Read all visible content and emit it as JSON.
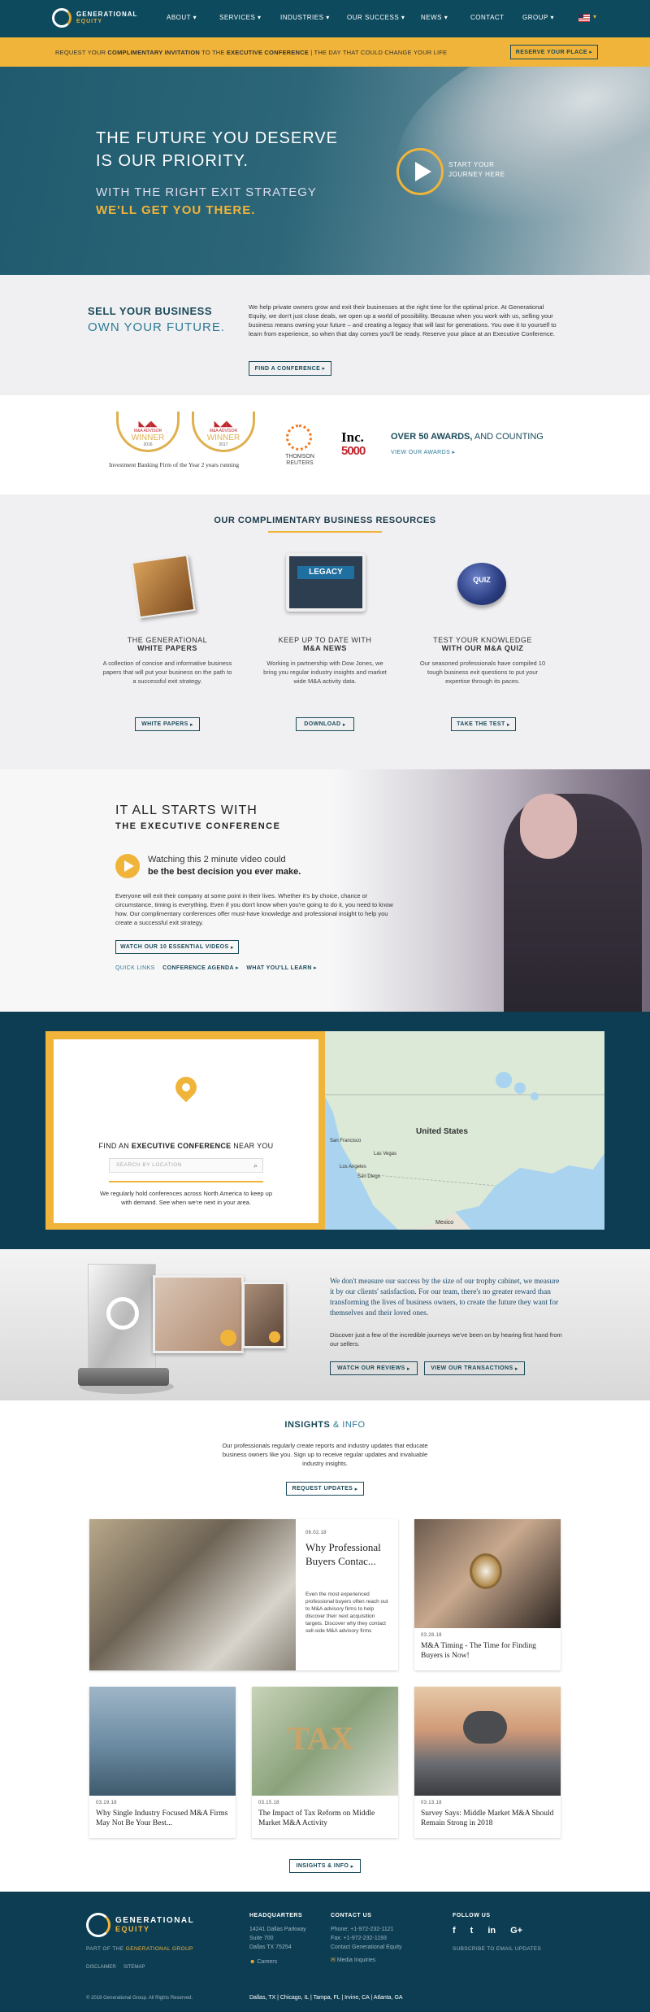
{
  "header": {
    "logo_line1": "GENERATIONAL",
    "logo_line2": "EQUITY",
    "nav": [
      "ABOUT",
      "SERVICES",
      "INDUSTRIES",
      "OUR SUCCESS",
      "NEWS",
      "CONTACT",
      "GROUP"
    ]
  },
  "banner": {
    "part1": "REQUEST YOUR ",
    "bold1": "COMPLIMENTARY INVITATION",
    "part2": " TO THE ",
    "bold2": "EXECUTIVE CONFERENCE",
    "part3": "  |  THE DAY THAT COULD CHANGE YOUR LIFE",
    "button": "RESERVE YOUR PLACE"
  },
  "hero": {
    "title_line1": "THE FUTURE YOU DESERVE",
    "title_line2": "IS OUR PRIORITY.",
    "sub1": "WITH THE RIGHT EXIT STRATEGY",
    "sub2": "WE'LL GET YOU THERE.",
    "start_line1": "START YOUR",
    "start_line2": "JOURNEY HERE"
  },
  "sell": {
    "title1": "SELL YOUR BUSINESS",
    "title2": "OWN YOUR FUTURE.",
    "paragraph": "We help private owners grow and exit their businesses at the right time for the optimal price. At Generational Equity, we don't just close deals, we open up a world of possibility. Because when you work with us, selling your business means owning your future – and creating a legacy that will last for generations. You owe it to yourself to learn from experience, so when that day comes you'll be ready. Reserve your place at an Executive Conference.",
    "button": "FIND A CONFERENCE"
  },
  "awards": {
    "badge1_brand": "M&A ADVISOR",
    "badge1_word": "WINNER",
    "badge1_year": "2016",
    "badge2_brand": "M&A ADVISOR",
    "badge2_word": "WINNER",
    "badge2_year": "2017",
    "caption": "Investment Banking Firm of the Year 2 years running",
    "thomson1": "THOMSON",
    "thomson2": "REUTERS",
    "inc_word": "Inc.",
    "inc_num": "5000",
    "count_bold": "OVER 50 AWARDS,",
    "count_rest": " AND COUNTING",
    "view": "VIEW OUR AWARDS"
  },
  "resources": {
    "heading": "OUR COMPLIMENTARY BUSINESS RESOURCES",
    "items": [
      {
        "t1": "THE GENERATIONAL",
        "t2": "WHITE PAPERS",
        "desc": "A collection of concise and informative business papers that will put your business on the path to a successful exit strategy.",
        "button": "WHITE PAPERS"
      },
      {
        "t1": "KEEP UP TO DATE WITH",
        "t2": "M&A NEWS",
        "desc": "Working in partnership with Dow Jones, we bring you regular industry insights and market wide M&A activity data.",
        "button": "DOWNLOAD"
      },
      {
        "t1": "TEST YOUR KNOWLEDGE",
        "t2": "WITH OUR M&A QUIZ",
        "desc": "Our seasoned professionals have compiled 10 tough business exit questions to put your expertise through its paces.",
        "button": "TAKE THE TEST"
      }
    ],
    "legacy_label": "LEGACY",
    "quiz_label": "QUIZ"
  },
  "video": {
    "h1": "IT ALL STARTS WITH",
    "h2": "THE EXECUTIVE CONFERENCE",
    "watch1": "Watching this 2 minute video could",
    "watch2": "be the best decision you ever make.",
    "paragraph": "Everyone will exit their company at some point in their lives. Whether it's by choice, chance or circumstance, timing is everything. Even if you don't know when you're going to do it, you need to know how. Our complimentary conferences offer must-have knowledge and professional insight to help you create a successful exit strategy.",
    "button": "WATCH OUR 10 ESSENTIAL VIDEOS",
    "quick": "QUICK LINKS",
    "link1": "CONFERENCE AGENDA",
    "link2": "WHAT YOU'LL LEARN"
  },
  "find": {
    "title_pre": "FIND AN ",
    "title_bold": "EXECUTIVE CONFERENCE",
    "title_post": " NEAR YOU",
    "placeholder": "SEARCH BY LOCATION",
    "desc": "We regularly hold conferences across North America to keep up with demand. See when we're next in your area.",
    "map_us": "United States",
    "map_mexico": "Mexico",
    "map_sf": "San Francisco",
    "map_la": "Los Angeles",
    "map_sd": "San Diego",
    "map_lv": "Las Vegas"
  },
  "trophy": {
    "quote": "We don't measure our success by the size of our trophy cabinet, we measure it by our clients' satisfaction. For our team, there's no greater reward than transforming the lives of business owners, to create the future they want for themselves and their loved ones.",
    "desc": "Discover just a few of the incredible journeys we've been on by hearing first hand from our sellers.",
    "button1": "WATCH OUR REVIEWS",
    "button2": "VIEW OUR TRANSACTIONS"
  },
  "insights": {
    "title_bold": "INSIGHTS",
    "title_rest": " & INFO",
    "desc": "Our professionals regularly create reports and industry updates that educate business owners like you. Sign up to receive regular updates and invaluable industry insights.",
    "button": "REQUEST UPDATES",
    "featured": {
      "date": "06.02.18",
      "title": "Why Professional Buyers Contac...",
      "excerpt": "Even the most experienced professional buyers often reach out to M&A advisory firms to help discover their next acquisition targets. Discover why they contact sell-side M&A advisory firms"
    },
    "cards": [
      {
        "date": "03.28.18",
        "title": "M&A Timing - The Time for Finding Buyers is Now!"
      },
      {
        "date": "03.19.18",
        "title": "Why Single Industry Focused M&A Firms May Not Be Your Best..."
      },
      {
        "date": "03.15.18",
        "title": "The Impact of Tax Reform on Middle Market M&A Activity"
      },
      {
        "date": "03.13.18",
        "title": "Survey Says: Middle Market M&A Should Remain Strong in 2018"
      }
    ],
    "tax_label": "TAX",
    "more_button": "INSIGHTS & INFO"
  },
  "footer": {
    "logo1": "GENERATIONAL",
    "logo2": "EQUITY",
    "part_of_pre": "PART OF THE ",
    "part_of_brand": "GENERATIONAL GROUP",
    "disclaimer": "DISCLAIMER",
    "sitemap": "SITEMAP",
    "copyright": "© 2018 Generational Group. All Rights Reserved.",
    "hq_title": "HEADQUARTERS",
    "hq_lines": [
      "14241 Dallas Parkway",
      "Suite 700",
      "Dallas TX 75254"
    ],
    "careers": "Careers",
    "contact_title": "CONTACT US",
    "phone": "Phone: +1-972-232-1121",
    "fax": "Fax: +1-972-232-1193",
    "contact_link": "Contact Generational Equity",
    "media": "Media Inquiries",
    "follow_title": "FOLLOW US",
    "subscribe": "SUBSCRIBE TO EMAIL UPDATES",
    "cities": "Dallas, TX  |  Chicago, IL  |  Tampa, FL  |  Irvine, CA  |  Atlanta, GA"
  },
  "colors": {
    "navy": "#0d4a5e",
    "gold": "#f0b43a",
    "teal": "#2d7a95"
  }
}
